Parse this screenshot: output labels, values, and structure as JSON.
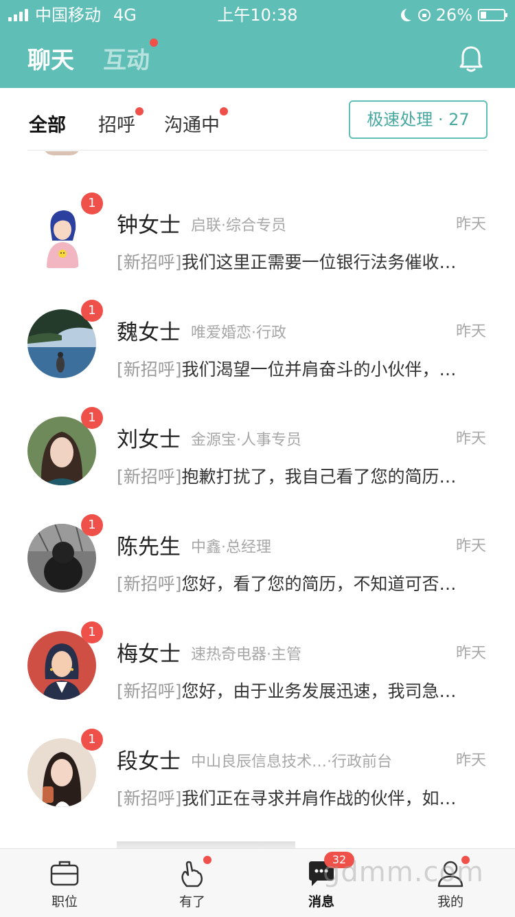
{
  "status_bar": {
    "carrier": "中国移动",
    "network": "4G",
    "time": "上午10:38",
    "battery": "26%",
    "battery_level": 0.26
  },
  "header": {
    "tabs": [
      {
        "label": "聊天",
        "active": true,
        "has_dot": false
      },
      {
        "label": "互动",
        "active": false,
        "has_dot": true
      }
    ],
    "bell_icon": "bell-icon"
  },
  "filters": {
    "tabs": [
      {
        "label": "全部",
        "active": true,
        "has_dot": false
      },
      {
        "label": "招呼",
        "active": false,
        "has_dot": true
      },
      {
        "label": "沟通中",
        "active": false,
        "has_dot": true
      }
    ],
    "speed_button": "极速处理 · 27"
  },
  "conversations": [
    {
      "name": "钟女士",
      "company": "启联·综合专员",
      "time": "昨天",
      "tag": "[新招呼]",
      "message": "我们这里正需要一位银行法务催收…",
      "unread": "1"
    },
    {
      "name": "魏女士",
      "company": "唯爱婚恋·行政",
      "time": "昨天",
      "tag": "[新招呼]",
      "message": "我们渴望一位并肩奋斗的小伙伴，…",
      "unread": "1"
    },
    {
      "name": "刘女士",
      "company": "金源宝·人事专员",
      "time": "昨天",
      "tag": "[新招呼]",
      "message": "抱歉打扰了，我自己看了您的简历…",
      "unread": "1"
    },
    {
      "name": "陈先生",
      "company": "中鑫·总经理",
      "time": "昨天",
      "tag": "[新招呼]",
      "message": "您好，看了您的简历，不知道可否…",
      "unread": "1"
    },
    {
      "name": "梅女士",
      "company": "速热奇电器·主管",
      "time": "昨天",
      "tag": "[新招呼]",
      "message": "您好，由于业务发展迅速，我司急…",
      "unread": "1"
    },
    {
      "name": "段女士",
      "company": "中山良辰信息技术…·行政前台",
      "time": "昨天",
      "tag": "[新招呼]",
      "message": "我们正在寻求并肩作战的伙伴，如…",
      "unread": "1"
    }
  ],
  "tabbar": {
    "tabs": [
      {
        "label": "职位",
        "icon": "briefcase-icon",
        "active": false
      },
      {
        "label": "有了",
        "icon": "hand-icon",
        "active": false
      },
      {
        "label": "消息",
        "icon": "message-icon",
        "active": true,
        "count": "32"
      },
      {
        "label": "我的",
        "icon": "user-icon",
        "active": false
      }
    ]
  },
  "watermark": "gdmm.com",
  "colors": {
    "brand": "#5fbfb7",
    "badge": "#f0504a",
    "speed_text": "#48a9a1"
  }
}
